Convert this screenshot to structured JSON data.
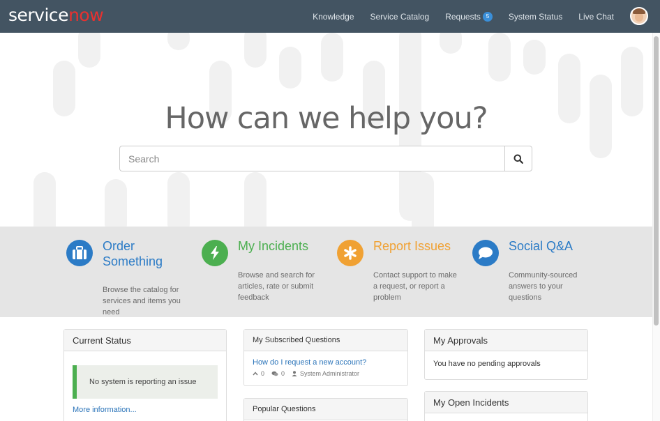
{
  "brand": {
    "logo_white": "service",
    "logo_red": "now",
    "accent": "#e8312f",
    "header_bg": "#435462"
  },
  "nav": {
    "knowledge": "Knowledge",
    "service_catalog": "Service Catalog",
    "requests": "Requests",
    "requests_count": "5",
    "system_status": "System Status",
    "live_chat": "Live Chat"
  },
  "hero": {
    "title": "How can we help you?",
    "search_placeholder": "Search"
  },
  "features": [
    {
      "title_line1": "Order",
      "title_line2": "Something",
      "desc": "Browse the catalog for services and items you need",
      "color": "#2b7bc6",
      "icon": "briefcase-icon"
    },
    {
      "title": "My Incidents",
      "desc": "Browse and search for articles, rate or submit feedback",
      "color": "#4caf50",
      "icon": "lightning-icon"
    },
    {
      "title": "Report Issues",
      "desc": "Contact support to make a request, or report a problem",
      "color": "#f0a133",
      "icon": "asterisk-icon"
    },
    {
      "title": "Social Q&A",
      "desc": "Community-sourced answers to your questions",
      "color": "#2b7bc6",
      "icon": "chat-bubble-icon"
    }
  ],
  "current_status": {
    "title": "Current Status",
    "message": "No system is reporting an issue",
    "more_link": "More information..."
  },
  "subscribed": {
    "title": "My Subscribed Questions",
    "question": "How do I request a new account?",
    "votes": "0",
    "answers": "0",
    "author": "System Administrator"
  },
  "popular": {
    "title": "Popular Questions"
  },
  "approvals": {
    "title": "My Approvals",
    "message": "You have no pending approvals"
  },
  "open_incidents": {
    "title": "My Open Incidents"
  }
}
